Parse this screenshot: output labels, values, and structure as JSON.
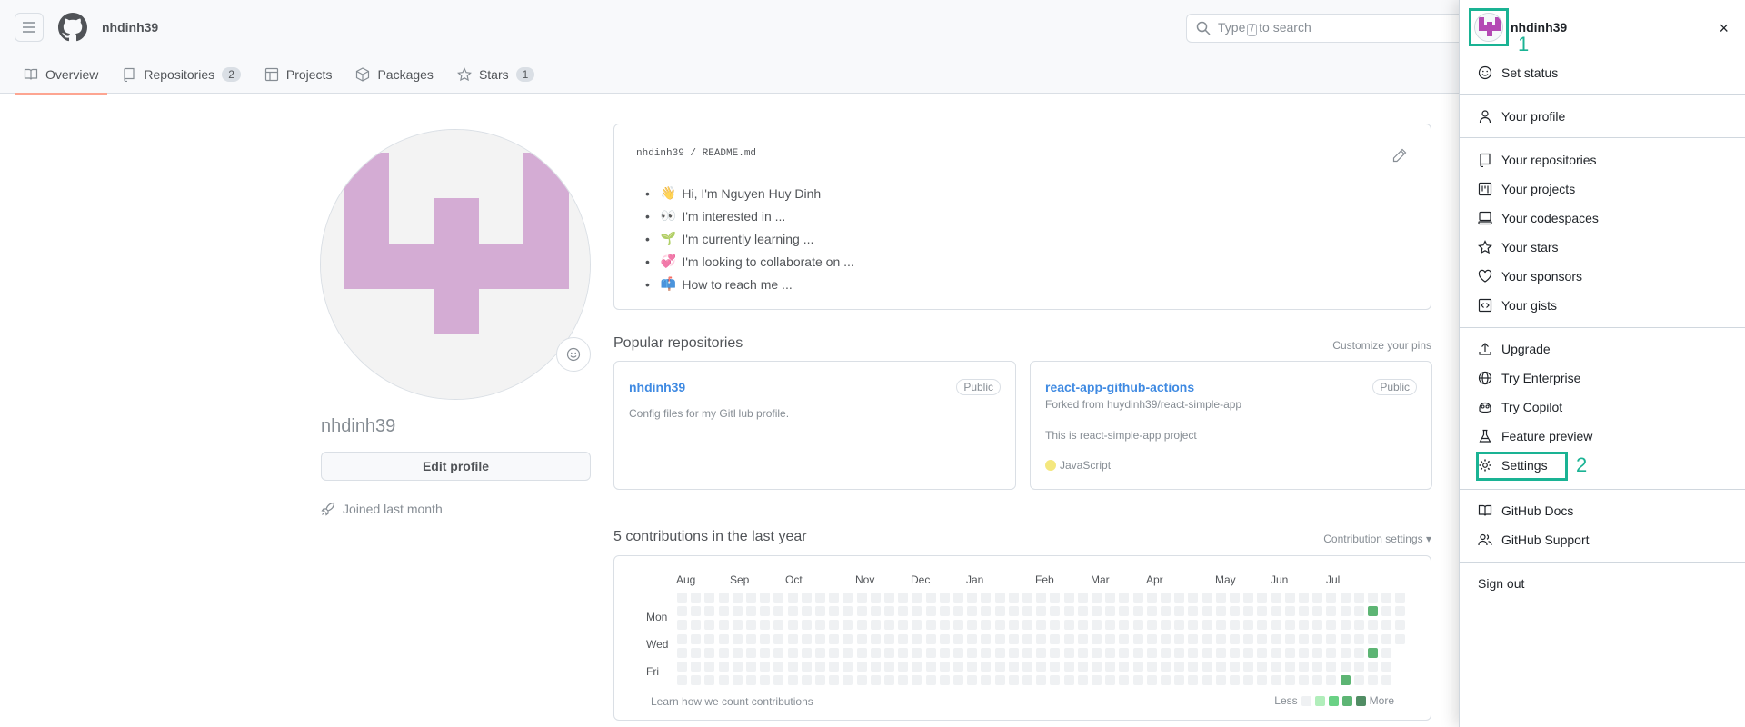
{
  "header": {
    "username": "nhdinh39",
    "search_prefix": "Type",
    "search_key": "/",
    "search_suffix": "to search"
  },
  "tabs": [
    {
      "label": "Overview",
      "count": null,
      "icon": "book-icon",
      "active": true
    },
    {
      "label": "Repositories",
      "count": "2",
      "icon": "repo-icon"
    },
    {
      "label": "Projects",
      "count": null,
      "icon": "table-icon"
    },
    {
      "label": "Packages",
      "count": null,
      "icon": "package-icon"
    },
    {
      "label": "Stars",
      "count": "1",
      "icon": "star-icon"
    }
  ],
  "profile": {
    "name": "nhdinh39",
    "edit_label": "Edit profile",
    "joined": "Joined last month"
  },
  "readme": {
    "path": "nhdinh39 / README.md",
    "items": [
      {
        "emoji": "👋",
        "text": "Hi, I'm Nguyen Huy Dinh"
      },
      {
        "emoji": "👀",
        "text": "I'm interested in ..."
      },
      {
        "emoji": "🌱",
        "text": "I'm currently learning ..."
      },
      {
        "emoji": "💞",
        "text": "I'm looking to collaborate on ..."
      },
      {
        "emoji": "📫",
        "text": "How to reach me ..."
      }
    ]
  },
  "popular": {
    "title": "Popular repositories",
    "customize": "Customize your pins",
    "repos": [
      {
        "name": "nhdinh39",
        "badge": "Public",
        "desc": "Config files for my GitHub profile.",
        "forked": "",
        "lang": ""
      },
      {
        "name": "react-app-github-actions",
        "badge": "Public",
        "forked": "Forked from huydinh39/react-simple-app",
        "desc": "This is react-simple-app project",
        "lang": "JavaScript"
      }
    ]
  },
  "contributions": {
    "title": "5 contributions in the last year",
    "settings": "Contribution settings ▾",
    "months": [
      "Aug",
      "Sep",
      "Oct",
      "Nov",
      "Dec",
      "Jan",
      "Feb",
      "Mar",
      "Apr",
      "May",
      "Jun",
      "Jul"
    ],
    "days": [
      "Mon",
      "Wed",
      "Fri"
    ],
    "footer": "Learn how we count contributions",
    "less": "Less",
    "more": "More",
    "colors": {
      "empty": "#ebedf0",
      "l1": "#9be9a8",
      "l2": "#40c463",
      "l3": "#30a14e",
      "l4": "#216e39"
    }
  },
  "menu": {
    "username": "nhdinh39",
    "close": "×",
    "callout_1": "1",
    "callout_2": "2",
    "items": [
      {
        "label": "Set status",
        "icon": "smiley-icon"
      },
      {
        "label": "Your profile",
        "icon": "person-icon"
      },
      {
        "label": "Your repositories",
        "icon": "repo-icon"
      },
      {
        "label": "Your projects",
        "icon": "project-icon"
      },
      {
        "label": "Your codespaces",
        "icon": "codespaces-icon"
      },
      {
        "label": "Your stars",
        "icon": "star-icon"
      },
      {
        "label": "Your sponsors",
        "icon": "heart-icon"
      },
      {
        "label": "Your gists",
        "icon": "code-square-icon"
      },
      {
        "label": "Upgrade",
        "icon": "upload-icon"
      },
      {
        "label": "Try Enterprise",
        "icon": "globe-icon"
      },
      {
        "label": "Try Copilot",
        "icon": "copilot-icon"
      },
      {
        "label": "Feature preview",
        "icon": "beaker-icon"
      },
      {
        "label": "Settings",
        "icon": "gear-icon"
      },
      {
        "label": "GitHub Docs",
        "icon": "book-icon"
      },
      {
        "label": "GitHub Support",
        "icon": "people-icon"
      },
      {
        "label": "Sign out",
        "icon": ""
      }
    ],
    "accent": "#1ab394"
  }
}
